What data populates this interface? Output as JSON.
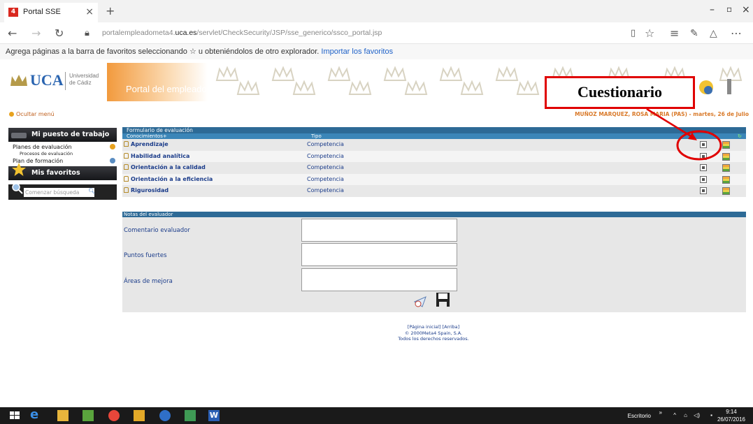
{
  "browser": {
    "tab_title": "Portal SSE",
    "favicon_text": "4",
    "url_prefix": "portalempleadometa4.",
    "url_domain": "uca.es",
    "url_path": "/servlet/CheckSecurity/JSP/sse_generico/ssco_portal.jsp",
    "favorites_bar_text": "Agrega páginas a la barra de favoritos seleccionando ☆ u obteniéndolos de otro explorador.",
    "favorites_bar_link": "Importar los favoritos"
  },
  "header": {
    "logo_text": "UCA",
    "logo_subtitle_1": "Universidad",
    "logo_subtitle_2": "de Cádiz",
    "portal_title": "Portal del empleado"
  },
  "annotation": {
    "label": "Cuestionario",
    "color": "#e00000"
  },
  "topline": {
    "hide_menu": "Ocultar menú",
    "user_info": "MUÑOZ MARQUEZ, ROSA MARIA (PAS) - martes, 26 de Julio"
  },
  "sidebar": {
    "section1_title": "Mi puesto de trabajo",
    "items": [
      {
        "label": "Planes de evaluación"
      },
      {
        "label": "Procesos de evaluación"
      },
      {
        "label": "Plan de formación"
      }
    ],
    "section2_title": "Mis favoritos",
    "search_placeholder": "Comenzar búsqueda"
  },
  "grid": {
    "caption": "Formulario de evaluación",
    "col_conocimientos": "Conocimientos+",
    "col_tipo": "Tipo",
    "rows": [
      {
        "name": "Aprendizaje",
        "tipo": "Competencia"
      },
      {
        "name": "Habilidad analítica",
        "tipo": "Competencia"
      },
      {
        "name": "Orientación a la calidad",
        "tipo": "Competencia"
      },
      {
        "name": "Orientación a la eficiencia",
        "tipo": "Competencia"
      },
      {
        "name": "Rigurosidad",
        "tipo": "Competencia"
      }
    ]
  },
  "notes": {
    "caption": "Notas del evaluador",
    "comentario": "Comentario evaluador",
    "puntos": "Puntos fuertes",
    "areas": "Áreas de mejora"
  },
  "footer": {
    "links": "[Página inicial] [Arriba]",
    "copyright": "© 2000Meta4 Spain, S.A.",
    "rights": "Todos los derechos reservados."
  },
  "taskbar": {
    "desktop_label": "Escritorio",
    "time": "9:14",
    "date": "26/07/2016"
  }
}
